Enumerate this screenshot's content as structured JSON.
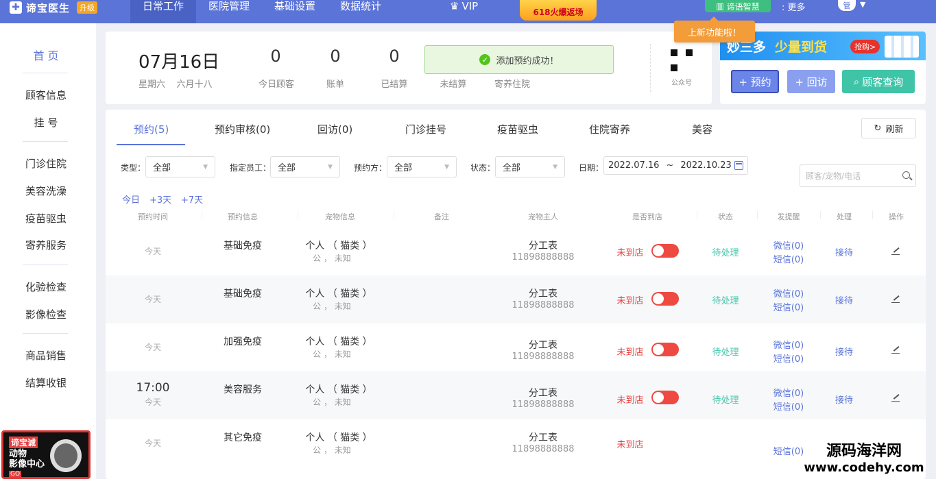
{
  "brand": {
    "logo": "谛宝医生",
    "upgrade": "升级"
  },
  "topnav": [
    "日常工作",
    "医院管理",
    "基础设置",
    "数据统计"
  ],
  "vip": "VIP",
  "promo": "618火爆返场",
  "smart": "谛语智慧",
  "more": ": 更多",
  "user": "管",
  "sidebar": {
    "home": "首 页",
    "items": [
      "顾客信息",
      "挂 号",
      "门诊住院",
      "美容洗澡",
      "疫苗驱虫",
      "寄养服务",
      "化验检查",
      "影像检查",
      "商品销售",
      "结算收银"
    ]
  },
  "side_ad": {
    "line1": "谛宝诚",
    "line2": "动物",
    "line3": "影像中心",
    "go": "GO"
  },
  "summary": {
    "date": "07月16日",
    "weekday": "星期六",
    "lunar": "六月十八",
    "stats": [
      {
        "value": "0",
        "label": "今日顾客"
      },
      {
        "value": "0",
        "label": "账单"
      },
      {
        "value": "0",
        "label": "已结算"
      },
      {
        "value": "",
        "label": "未结算"
      },
      {
        "value": "",
        "label": "寄养住院"
      }
    ],
    "toast": "添加预约成功！",
    "qr_label": "公众号"
  },
  "new_feature": "上新功能啦！",
  "banner": {
    "b1": "妙三多",
    "b2": "少量到货",
    "buy": "抢购>"
  },
  "actions": {
    "appointment": "+ 预约",
    "revisit": "+ 回访",
    "search": "顾客查询"
  },
  "tabs": [
    "预约(5)",
    "预约审核(0)",
    "回访(0)",
    "门诊挂号",
    "疫苗驱虫",
    "住院寄养",
    "美容"
  ],
  "refresh": "刷新",
  "filters": {
    "type_label": "类型：",
    "type_value": "全部",
    "staff_label": "指定员工：",
    "staff_value": "全部",
    "booker_label": "预约方：",
    "booker_value": "全部",
    "status_label": "状态：",
    "status_value": "全部",
    "date_label": "日期：",
    "date_from": "2022.07.16",
    "date_sep": "~",
    "date_to": "2022.10.23",
    "search_placeholder": "顾客/宠物/电话"
  },
  "quick": [
    "今日",
    "+3天",
    "+7天"
  ],
  "columns": [
    "预约时间",
    "预约信息",
    "宠物信息",
    "备注",
    "宠物主人",
    "是否到店",
    "状态",
    "发提醒",
    "处理",
    "操作"
  ],
  "rows": [
    {
      "time": "",
      "day": "今天",
      "type": "基础免疫",
      "pet": "个人 （ 猫类 ）",
      "pet_sub": "公 ， 未知",
      "owner": "分工表",
      "phone": "11898888888",
      "arrive": "未到店",
      "status": "待处理",
      "wechat": "微信(0)",
      "sms": "短信(0)",
      "handle": "接待"
    },
    {
      "time": "",
      "day": "今天",
      "type": "基础免疫",
      "pet": "个人 （ 猫类 ）",
      "pet_sub": "公 ， 未知",
      "owner": "分工表",
      "phone": "11898888888",
      "arrive": "未到店",
      "status": "待处理",
      "wechat": "微信(0)",
      "sms": "短信(0)",
      "handle": "接待"
    },
    {
      "time": "",
      "day": "今天",
      "type": "加强免疫",
      "pet": "个人 （ 猫类 ）",
      "pet_sub": "公 ， 未知",
      "owner": "分工表",
      "phone": "11898888888",
      "arrive": "未到店",
      "status": "待处理",
      "wechat": "微信(0)",
      "sms": "短信(0)",
      "handle": "接待"
    },
    {
      "time": "17:00",
      "day": "今天",
      "type": "美容服务",
      "pet": "个人 （ 猫类 ）",
      "pet_sub": "公 ， 未知",
      "owner": "分工表",
      "phone": "11898888888",
      "arrive": "未到店",
      "status": "待处理",
      "wechat": "微信(0)",
      "sms": "短信(0)",
      "handle": "接待"
    },
    {
      "time": "",
      "day": "今天",
      "type": "其它免疫",
      "pet": "个人 （ 猫类 ）",
      "pet_sub": "公 ， 未知",
      "owner": "分工表",
      "phone": "11898888888",
      "arrive": "未到店",
      "status": "",
      "wechat": "",
      "sms": "短信(0)",
      "handle": ""
    }
  ],
  "watermark": {
    "line1": "源码海洋网",
    "line2": "www.codehy.com"
  }
}
